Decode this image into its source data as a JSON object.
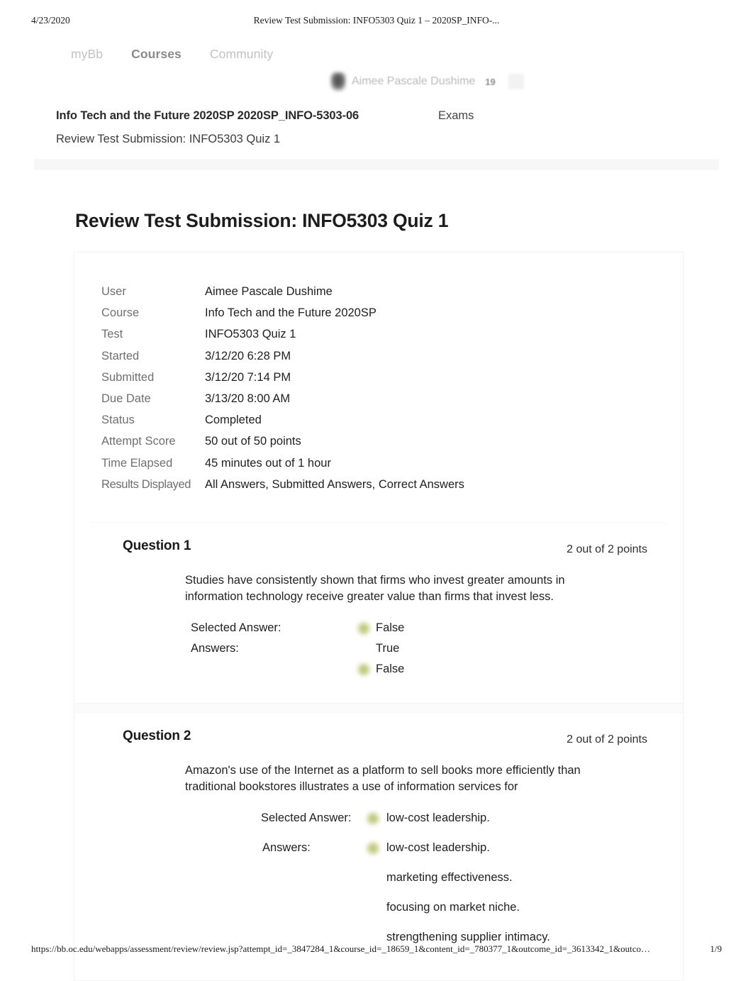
{
  "print": {
    "date": "4/23/2020",
    "title": "Review Test Submission: INFO5303 Quiz 1 – 2020SP_INFO-...",
    "url": "https://bb.oc.edu/webapps/assessment/review/review.jsp?attempt_id=_3847284_1&course_id=_18659_1&content_id=_780377_1&outcome_id=_3613342_1&outco…",
    "page": "1/9"
  },
  "nav": {
    "links": [
      {
        "label": "myBb",
        "active": false
      },
      {
        "label": "Courses",
        "active": true
      },
      {
        "label": "Community",
        "active": false
      }
    ],
    "user_name": "Aimee Pascale Dushime",
    "notification_count": "19"
  },
  "breadcrumb": {
    "course": "Info Tech and the Future 2020SP 2020SP_INFO-5303-06",
    "section": "Exams",
    "current": "Review Test Submission: INFO5303 Quiz 1"
  },
  "page_title": "Review Test Submission: INFO5303 Quiz 1",
  "info": {
    "rows": [
      {
        "label": "User",
        "value": "Aimee Pascale Dushime"
      },
      {
        "label": "Course",
        "value": "Info Tech and the Future 2020SP"
      },
      {
        "label": "Test",
        "value": "INFO5303 Quiz 1"
      },
      {
        "label": "Started",
        "value": "3/12/20 6:28 PM"
      },
      {
        "label": "Submitted",
        "value": "3/12/20 7:14 PM"
      },
      {
        "label": "Due Date",
        "value": "3/13/20 8:00 AM"
      },
      {
        "label": "Status",
        "value": "Completed"
      },
      {
        "label": "Attempt Score",
        "value": "50 out of 50 points"
      },
      {
        "label": "Time Elapsed",
        "value": "45 minutes out of 1 hour"
      },
      {
        "label": "Results Displayed",
        "value": "All Answers, Submitted Answers, Correct Answers"
      }
    ]
  },
  "questions": [
    {
      "title": "Question 1",
      "points": "2 out of 2 points",
      "text": "Studies have consistently shown that firms who invest greater amounts in information technology receive greater value than firms that invest less.",
      "selected_label": "Selected Answer:",
      "selected_value": "False",
      "answers_label": "Answers:",
      "answers": [
        {
          "value": "True",
          "marked": false
        },
        {
          "value": "False",
          "marked": true
        }
      ]
    },
    {
      "title": "Question 2",
      "points": "2 out of 2 points",
      "text": "Amazon's use of the Internet as a platform to sell books more efficiently than traditional bookstores illustrates a use of information services for",
      "selected_label": "Selected Answer:",
      "selected_value": "low-cost leadership.",
      "answers_label": "Answers:",
      "answers": [
        {
          "value": "low-cost leadership.",
          "marked": true
        },
        {
          "value": "marketing effectiveness.",
          "marked": false
        },
        {
          "value": "focusing on market niche.",
          "marked": false
        },
        {
          "value": "strengthening supplier intimacy.",
          "marked": false
        }
      ]
    }
  ],
  "colors": {
    "marker_green": "#c5cd86",
    "text_primary": "#212121",
    "text_muted": "#6f6f6f",
    "crumb_bar": "#f7f7f8"
  }
}
